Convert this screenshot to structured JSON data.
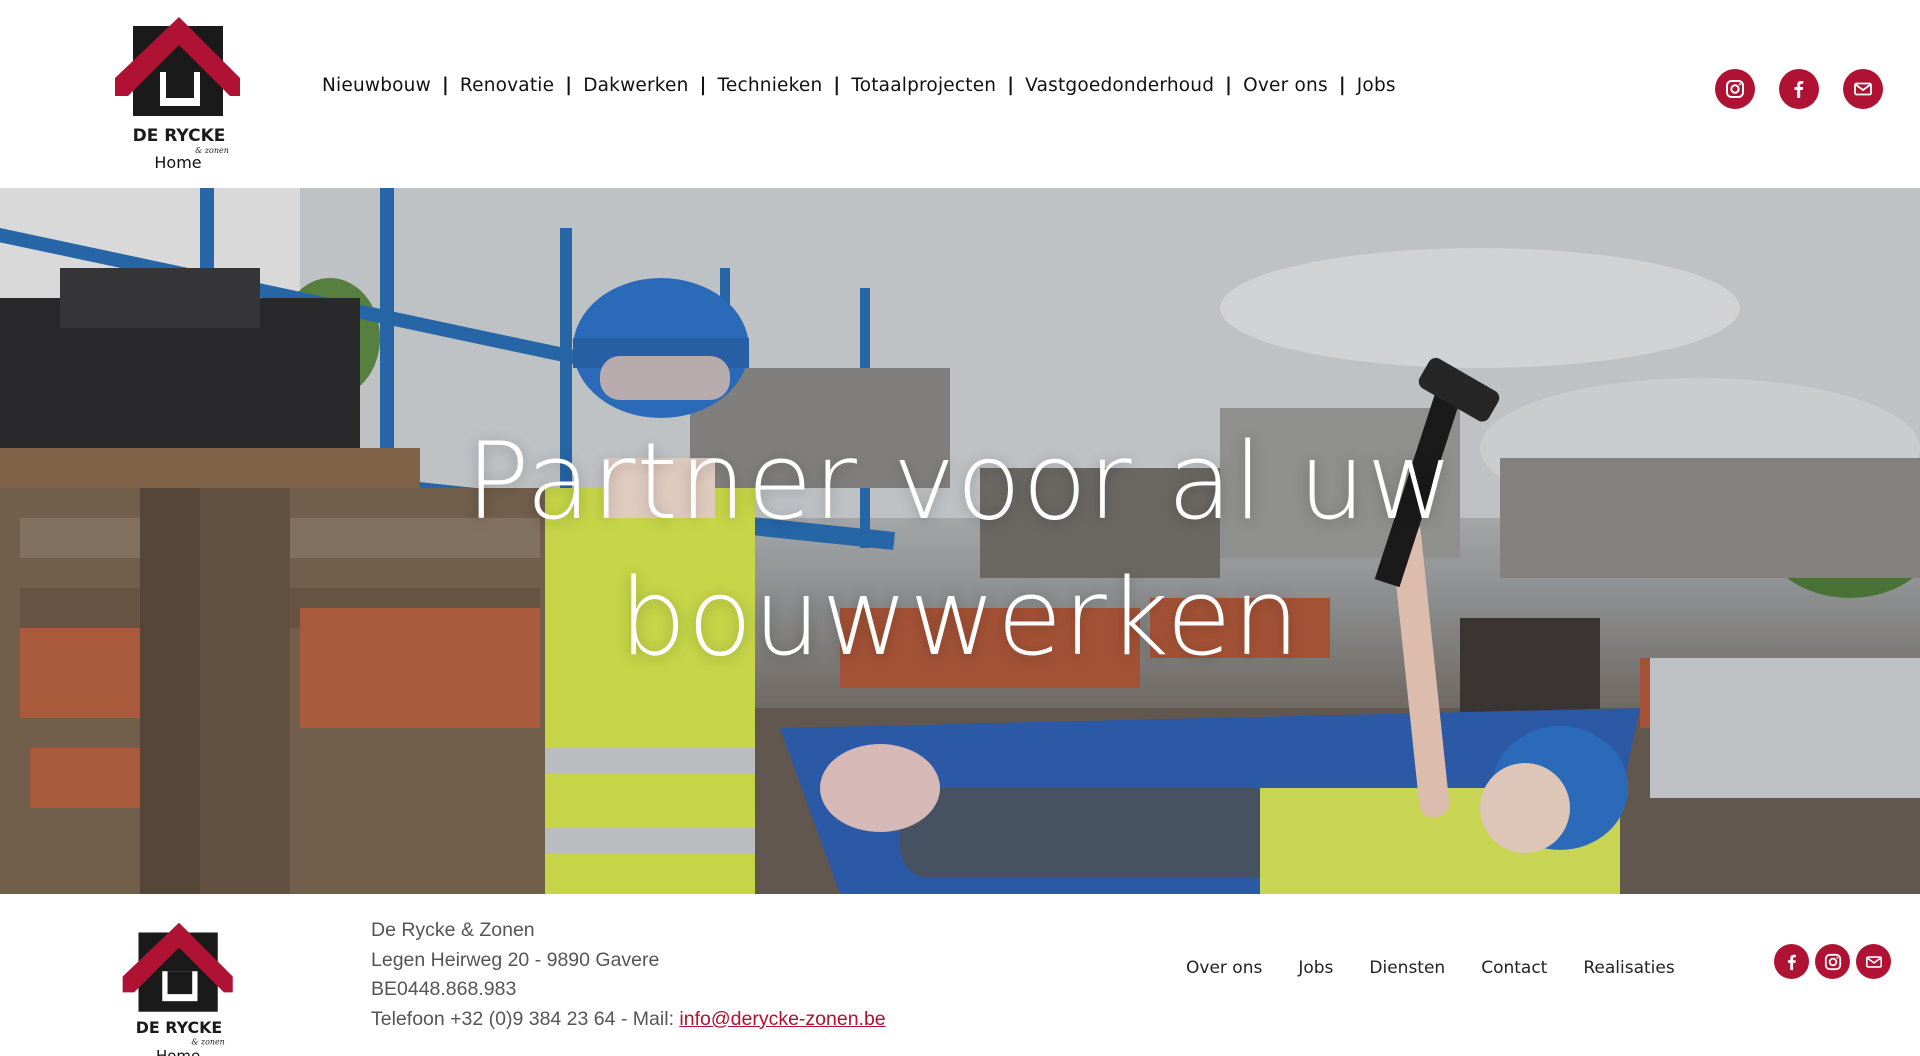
{
  "brand": {
    "name": "DE RYCKE",
    "tagline": "& zonen",
    "home_label": "Home",
    "accent": "#b01233",
    "dark": "#1a1a1a"
  },
  "nav": {
    "items": [
      "Nieuwbouw",
      "Renovatie",
      "Dakwerken",
      "Technieken",
      "Totaalprojecten",
      "Vastgoedonderhoud",
      "Over ons",
      "Jobs"
    ]
  },
  "social": [
    "instagram-icon",
    "facebook-icon",
    "mail-icon"
  ],
  "hero": {
    "title_line1": "Partner voor al uw",
    "title_line2": "bouwwerken"
  },
  "footer": {
    "company": "De Rycke & Zonen",
    "address": "Legen Heirweg 20 - 9890 Gavere",
    "vat": "BE0448.868.983",
    "contact_prefix": "Telefoon +32 (0)9 384 23 64 - Mail: ",
    "email": "info@derycke-zonen.be",
    "nav": [
      "Over ons",
      "Jobs",
      "Diensten",
      "Contact",
      "Realisaties"
    ],
    "social": [
      "facebook-icon",
      "instagram-icon",
      "mail-icon"
    ]
  }
}
